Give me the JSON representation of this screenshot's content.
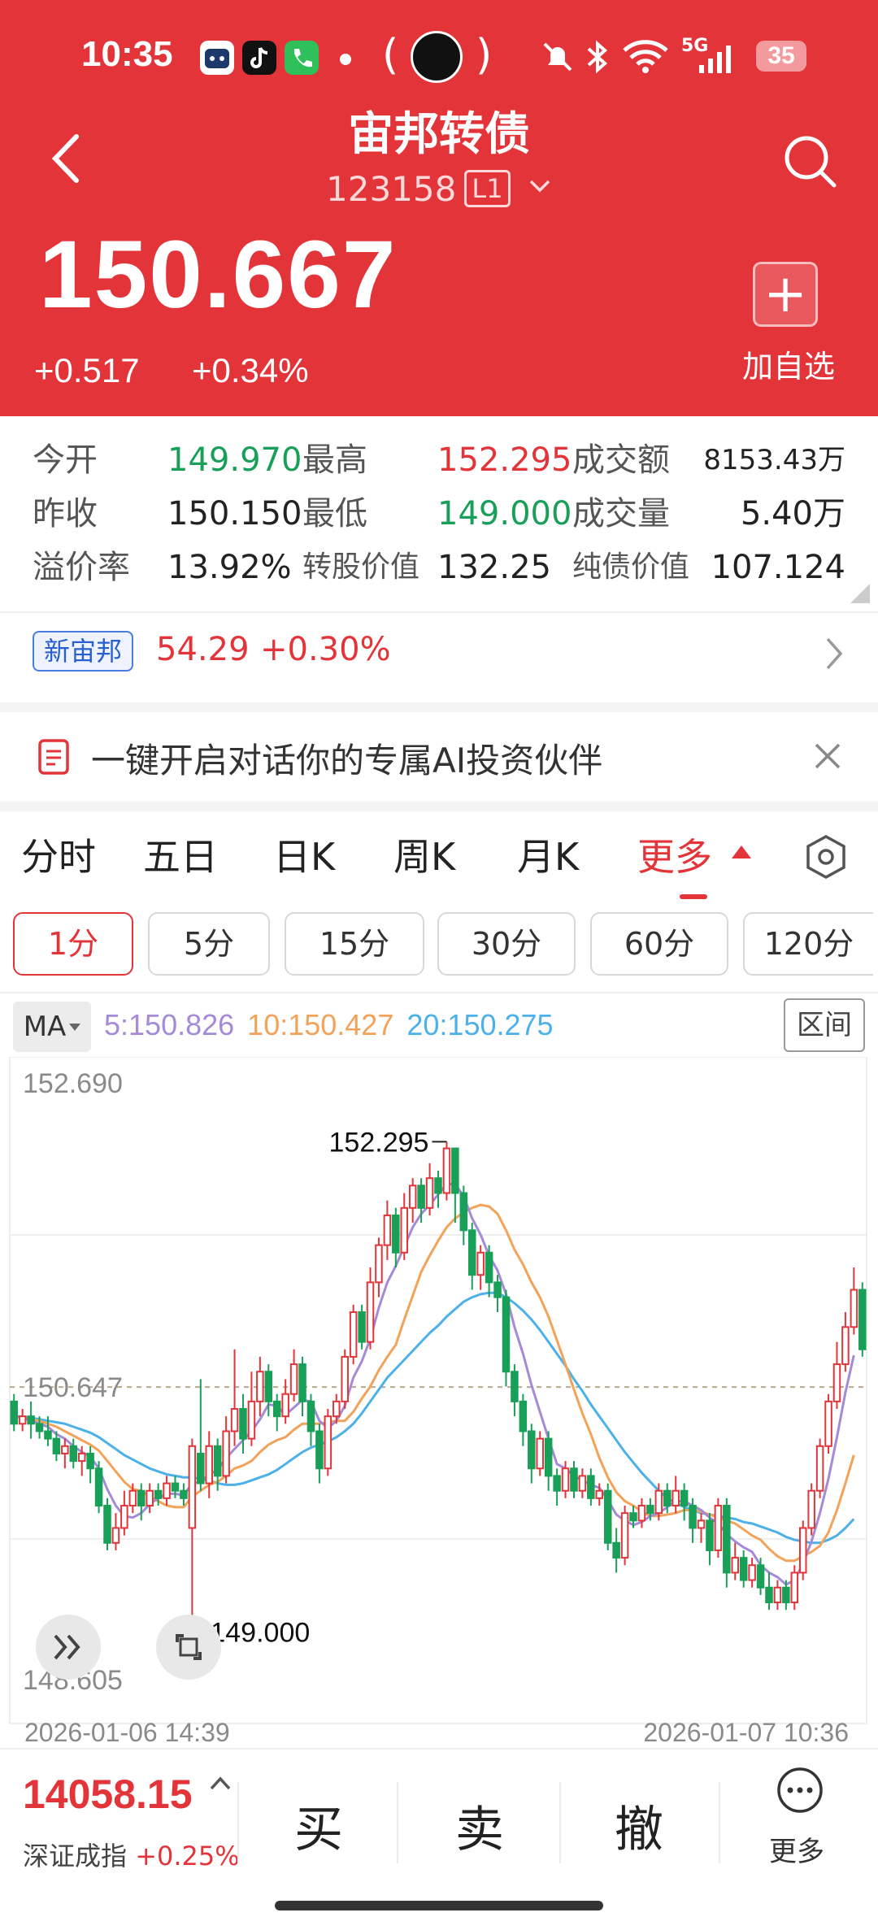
{
  "status_bar": {
    "time": "10:35",
    "network": "5G",
    "battery": "35",
    "icons": [
      "cat-app-icon",
      "tiktok-icon",
      "phone-app-icon",
      "notification-dot",
      "center-badge-icon",
      "mute-icon",
      "bluetooth-icon",
      "wifi-icon",
      "signal-icon"
    ]
  },
  "header": {
    "title": "宙邦转债",
    "code": "123158",
    "level_badge": "L1",
    "price": "150.667",
    "change": "+0.517",
    "change_pct": "+0.34%",
    "add_label": "加自选",
    "background_color": "#e3343a"
  },
  "stats": {
    "open_label": "今开",
    "open": "149.970",
    "high_label": "最高",
    "high": "152.295",
    "turnover_label": "成交额",
    "turnover": "8153.43万",
    "prev_close_label": "昨收",
    "prev_close": "150.150",
    "low_label": "最低",
    "low": "149.000",
    "volume_label": "成交量",
    "volume": "5.40万",
    "premium_label": "溢价率",
    "premium": "13.92%",
    "conv_value_label": "转股价值",
    "conv_value": "132.25",
    "bond_value_label": "纯债价值",
    "bond_value": "107.124"
  },
  "underlying": {
    "tag": "新宙邦",
    "price": "54.29",
    "change_pct": "+0.30%"
  },
  "ai_banner": {
    "text": "一键开启对话你的专属AI投资伙伴"
  },
  "tabs": [
    "分时",
    "五日",
    "日K",
    "周K",
    "月K",
    "更多"
  ],
  "active_tab": "更多",
  "intervals": [
    "1分",
    "5分",
    "15分",
    "30分",
    "60分",
    "120分"
  ],
  "active_interval": "1分",
  "ma_bar": {
    "button": "MA",
    "ma5": "5:150.826",
    "ma10": "10:150.427",
    "ma20": "20:150.275",
    "range_button": "区间",
    "colors": {
      "ma5": "#a58ad8",
      "ma10": "#f3a25a",
      "ma20": "#4cb1e8"
    }
  },
  "chart_data": {
    "type": "candlestick",
    "y_axis_labels": [
      "152.690",
      "150.647",
      "148.605"
    ],
    "ylim": [
      148.605,
      152.69
    ],
    "max_label": "152.295",
    "min_label": "149.000",
    "x_labels": [
      "2026-01-06 14:39",
      "2026-01-07 10:36"
    ],
    "up_color": "#e3343a",
    "down_color": "#18a058",
    "candles": [
      [
        150.55,
        150.4,
        150.6,
        150.35
      ],
      [
        150.4,
        150.45,
        150.5,
        150.35
      ],
      [
        150.45,
        150.4,
        150.55,
        150.3
      ],
      [
        150.4,
        150.35,
        150.45,
        150.3
      ],
      [
        150.35,
        150.3,
        150.45,
        150.25
      ],
      [
        150.3,
        150.2,
        150.35,
        150.15
      ],
      [
        150.2,
        150.25,
        150.3,
        150.1
      ],
      [
        150.25,
        150.15,
        150.3,
        150.1
      ],
      [
        150.15,
        150.2,
        150.25,
        150.05
      ],
      [
        150.2,
        150.1,
        150.25,
        150.0
      ],
      [
        150.1,
        149.85,
        150.15,
        149.8
      ],
      [
        149.85,
        149.6,
        149.9,
        149.55
      ],
      [
        149.6,
        149.7,
        149.8,
        149.55
      ],
      [
        149.7,
        149.85,
        149.95,
        149.65
      ],
      [
        149.85,
        149.95,
        150.0,
        149.8
      ],
      [
        149.95,
        149.85,
        150.0,
        149.75
      ],
      [
        149.85,
        149.95,
        150.0,
        149.8
      ],
      [
        149.95,
        149.9,
        150.0,
        149.85
      ],
      [
        149.9,
        150.0,
        150.05,
        149.85
      ],
      [
        150.0,
        149.95,
        150.05,
        149.9
      ],
      [
        149.95,
        149.9,
        150.0,
        149.85
      ],
      [
        149.7,
        150.25,
        150.3,
        149.0
      ],
      [
        150.2,
        150.0,
        150.7,
        149.95
      ],
      [
        150.0,
        150.25,
        150.35,
        149.9
      ],
      [
        150.25,
        150.05,
        150.3,
        149.95
      ],
      [
        150.05,
        150.35,
        150.45,
        150.0
      ],
      [
        150.35,
        150.5,
        150.9,
        150.25
      ],
      [
        150.5,
        150.3,
        150.6,
        150.2
      ],
      [
        150.3,
        150.55,
        150.75,
        150.25
      ],
      [
        150.55,
        150.75,
        150.85,
        150.45
      ],
      [
        150.75,
        150.55,
        150.8,
        150.45
      ],
      [
        150.55,
        150.45,
        150.6,
        150.35
      ],
      [
        150.45,
        150.6,
        150.7,
        150.4
      ],
      [
        150.6,
        150.8,
        150.9,
        150.55
      ],
      [
        150.8,
        150.55,
        150.85,
        150.45
      ],
      [
        150.55,
        150.35,
        150.6,
        150.25
      ],
      [
        150.35,
        150.1,
        150.4,
        150.0
      ],
      [
        150.1,
        150.45,
        150.5,
        150.05
      ],
      [
        150.45,
        150.55,
        150.6,
        150.4
      ],
      [
        150.55,
        150.85,
        150.9,
        150.5
      ],
      [
        150.85,
        151.15,
        151.2,
        150.8
      ],
      [
        151.15,
        150.95,
        151.2,
        150.9
      ],
      [
        150.95,
        151.35,
        151.45,
        150.9
      ],
      [
        151.35,
        151.6,
        151.65,
        151.25
      ],
      [
        151.6,
        151.8,
        151.9,
        151.5
      ],
      [
        151.8,
        151.55,
        151.85,
        151.45
      ],
      [
        151.55,
        151.85,
        151.95,
        151.5
      ],
      [
        151.85,
        152.0,
        152.05,
        151.75
      ],
      [
        152.0,
        151.85,
        152.05,
        151.75
      ],
      [
        151.85,
        152.05,
        152.15,
        151.8
      ],
      [
        152.05,
        151.95,
        152.1,
        151.85
      ],
      [
        151.95,
        152.25,
        152.295,
        151.9
      ],
      [
        152.25,
        151.95,
        152.25,
        151.75
      ],
      [
        151.95,
        151.7,
        152.0,
        151.6
      ],
      [
        151.7,
        151.4,
        151.75,
        151.3
      ],
      [
        151.4,
        151.55,
        151.6,
        151.3
      ],
      [
        151.55,
        151.35,
        151.6,
        151.25
      ],
      [
        151.35,
        151.25,
        151.4,
        151.15
      ],
      [
        151.25,
        150.75,
        151.3,
        150.65
      ],
      [
        150.75,
        150.55,
        150.8,
        150.45
      ],
      [
        150.55,
        150.35,
        150.6,
        150.25
      ],
      [
        150.35,
        150.1,
        150.4,
        150.0
      ],
      [
        150.1,
        150.3,
        150.35,
        150.05
      ],
      [
        150.3,
        150.05,
        150.35,
        149.95
      ],
      [
        150.05,
        149.95,
        150.1,
        149.85
      ],
      [
        149.95,
        150.1,
        150.15,
        149.9
      ],
      [
        150.1,
        149.95,
        150.15,
        149.9
      ],
      [
        149.95,
        150.05,
        150.1,
        149.9
      ],
      [
        150.05,
        149.9,
        150.1,
        149.85
      ],
      [
        149.9,
        149.95,
        150.0,
        149.85
      ],
      [
        149.95,
        149.6,
        150.0,
        149.55
      ],
      [
        149.6,
        149.5,
        149.7,
        149.4
      ],
      [
        149.5,
        149.8,
        149.85,
        149.45
      ],
      [
        149.8,
        149.75,
        149.85,
        149.7
      ],
      [
        149.75,
        149.85,
        149.9,
        149.7
      ],
      [
        149.85,
        149.8,
        149.9,
        149.75
      ],
      [
        149.8,
        149.95,
        150.0,
        149.75
      ],
      [
        149.95,
        149.85,
        150.0,
        149.8
      ],
      [
        149.85,
        149.95,
        150.05,
        149.8
      ],
      [
        149.95,
        149.85,
        150.0,
        149.75
      ],
      [
        149.85,
        149.7,
        149.9,
        149.6
      ],
      [
        149.7,
        149.75,
        149.8,
        149.6
      ],
      [
        149.75,
        149.55,
        149.8,
        149.45
      ],
      [
        149.55,
        149.85,
        149.9,
        149.5
      ],
      [
        149.85,
        149.4,
        149.9,
        149.3
      ],
      [
        149.4,
        149.5,
        149.6,
        149.35
      ],
      [
        149.5,
        149.35,
        149.55,
        149.3
      ],
      [
        149.35,
        149.45,
        149.5,
        149.3
      ],
      [
        149.45,
        149.3,
        149.5,
        149.25
      ],
      [
        149.3,
        149.2,
        149.4,
        149.15
      ],
      [
        149.2,
        149.3,
        149.35,
        149.15
      ],
      [
        149.3,
        149.2,
        149.35,
        149.15
      ],
      [
        149.2,
        149.4,
        149.45,
        149.15
      ],
      [
        149.4,
        149.7,
        149.75,
        149.35
      ],
      [
        149.7,
        149.95,
        150.0,
        149.65
      ],
      [
        149.95,
        150.25,
        150.3,
        149.9
      ],
      [
        150.25,
        150.55,
        150.6,
        150.2
      ],
      [
        150.55,
        150.8,
        150.95,
        150.5
      ],
      [
        150.8,
        151.05,
        151.15,
        150.75
      ],
      [
        151.05,
        151.3,
        151.45,
        151.0
      ],
      [
        151.3,
        150.9,
        151.35,
        150.85
      ]
    ],
    "ma5": [
      150.45,
      150.44,
      150.42,
      150.4,
      150.38,
      150.33,
      150.3,
      150.25,
      150.21,
      150.18,
      150.1,
      149.96,
      149.85,
      149.78,
      149.77,
      149.8,
      149.86,
      149.9,
      149.93,
      149.93,
      149.92,
      150.0,
      150.01,
      150.06,
      150.09,
      150.17,
      150.23,
      150.29,
      150.35,
      150.43,
      150.53,
      150.52,
      150.46,
      150.51,
      150.56,
      150.55,
      150.42,
      150.37,
      150.42,
      150.52,
      150.71,
      150.82,
      150.97,
      151.18,
      151.35,
      151.46,
      151.59,
      151.72,
      151.81,
      151.87,
      151.94,
      152.01,
      152.01,
      151.93,
      151.78,
      151.67,
      151.53,
      151.43,
      151.27,
      151.05,
      150.87,
      150.66,
      150.48,
      150.3,
      150.13,
      150.1,
      150.05,
      150.02,
      149.99,
      149.97,
      149.89,
      149.79,
      149.75,
      149.72,
      149.74,
      149.78,
      149.8,
      149.84,
      149.88,
      149.88,
      149.85,
      149.82,
      149.77,
      149.73,
      149.66,
      149.61,
      149.57,
      149.54,
      149.45,
      149.4,
      149.37,
      149.32,
      149.35,
      149.46,
      149.61,
      149.8,
      150.03,
      150.31,
      150.61,
      150.86
    ],
    "ma10": [
      150.45,
      150.44,
      150.43,
      150.42,
      150.4,
      150.38,
      150.35,
      150.32,
      150.29,
      150.26,
      150.22,
      150.15,
      150.08,
      150.01,
      149.96,
      149.95,
      149.91,
      149.88,
      149.85,
      149.84,
      149.84,
      149.91,
      149.95,
      149.99,
      150.01,
      150.05,
      150.1,
      150.12,
      150.15,
      150.21,
      150.26,
      150.29,
      150.31,
      150.36,
      150.4,
      150.4,
      150.4,
      150.41,
      150.42,
      150.42,
      150.48,
      150.57,
      150.65,
      150.76,
      150.85,
      150.93,
      151.1,
      151.26,
      151.42,
      151.53,
      151.63,
      151.72,
      151.78,
      151.82,
      151.85,
      151.87,
      151.86,
      151.81,
      151.7,
      151.57,
      151.47,
      151.35,
      151.25,
      151.12,
      150.96,
      150.8,
      150.63,
      150.47,
      150.33,
      150.17,
      150.04,
      149.94,
      149.88,
      149.85,
      149.81,
      149.78,
      149.78,
      149.79,
      149.8,
      149.82,
      149.82,
      149.81,
      149.79,
      149.77,
      149.75,
      149.73,
      149.69,
      149.65,
      149.62,
      149.56,
      149.51,
      149.48,
      149.48,
      149.51,
      149.54,
      149.58,
      149.67,
      149.82,
      150.0,
      150.19
    ],
    "ma20": [
      150.45,
      150.45,
      150.44,
      150.43,
      150.42,
      150.41,
      150.4,
      150.38,
      150.36,
      150.34,
      150.31,
      150.27,
      150.23,
      150.19,
      150.16,
      150.13,
      150.1,
      150.08,
      150.06,
      150.05,
      150.04,
      150.04,
      150.03,
      150.02,
      150.0,
      149.99,
      149.99,
      150.0,
      150.02,
      150.04,
      150.06,
      150.09,
      150.13,
      150.17,
      150.21,
      150.24,
      150.26,
      150.28,
      150.31,
      150.35,
      150.4,
      150.47,
      150.55,
      150.63,
      150.71,
      150.77,
      150.83,
      150.89,
      150.95,
      151.01,
      151.06,
      151.12,
      151.17,
      151.22,
      151.25,
      151.27,
      151.28,
      151.28,
      151.25,
      151.21,
      151.16,
      151.1,
      151.03,
      150.95,
      150.87,
      150.79,
      150.7,
      150.62,
      150.53,
      150.45,
      150.37,
      150.29,
      150.21,
      150.14,
      150.07,
      150.01,
      149.95,
      149.9,
      149.87,
      149.84,
      149.82,
      149.8,
      149.79,
      149.78,
      149.77,
      149.76,
      149.74,
      149.73,
      149.71,
      149.69,
      149.67,
      149.64,
      149.62,
      149.61,
      149.6,
      149.6,
      149.62,
      149.65,
      149.7,
      149.76
    ]
  },
  "bottom_bar": {
    "index_value": "14058.15",
    "index_name": "深证成指",
    "index_change": "+0.25%",
    "buy": "买",
    "sell": "卖",
    "cancel": "撤",
    "more": "更多"
  }
}
